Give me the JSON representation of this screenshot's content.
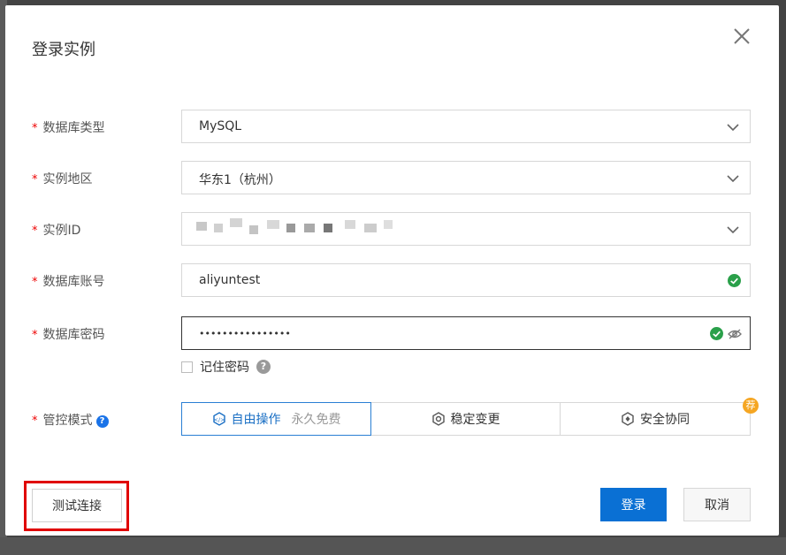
{
  "dialog": {
    "title": "登录实例",
    "close_icon": "close-icon"
  },
  "form": {
    "required_mark": "*",
    "db_type": {
      "label": "数据库类型",
      "value": "MySQL"
    },
    "region": {
      "label": "实例地区",
      "value": "华东1（杭州）"
    },
    "instance_id": {
      "label": "实例ID",
      "value": ""
    },
    "account": {
      "label": "数据库账号",
      "value": "aliyuntest"
    },
    "password": {
      "label": "数据库密码",
      "value": "••••••••••••••••"
    },
    "remember": {
      "label": "记住密码",
      "help": "?"
    },
    "control_mode": {
      "label": "管控模式",
      "info": "?",
      "options": [
        {
          "label": "自由操作",
          "sub": "永久免费",
          "icon": "free-op-icon",
          "active": true
        },
        {
          "label": "稳定变更",
          "icon": "stable-change-icon",
          "active": false
        },
        {
          "label": "安全协同",
          "icon": "secure-collab-icon",
          "active": false
        }
      ],
      "badge": "荐"
    }
  },
  "buttons": {
    "test": "测试连接",
    "login": "登录",
    "cancel": "取消"
  },
  "colors": {
    "primary": "#0a70d4",
    "ok_green": "#2aa04a",
    "required": "#e00000",
    "badge": "#f5a623",
    "highlight": "#e00000"
  }
}
